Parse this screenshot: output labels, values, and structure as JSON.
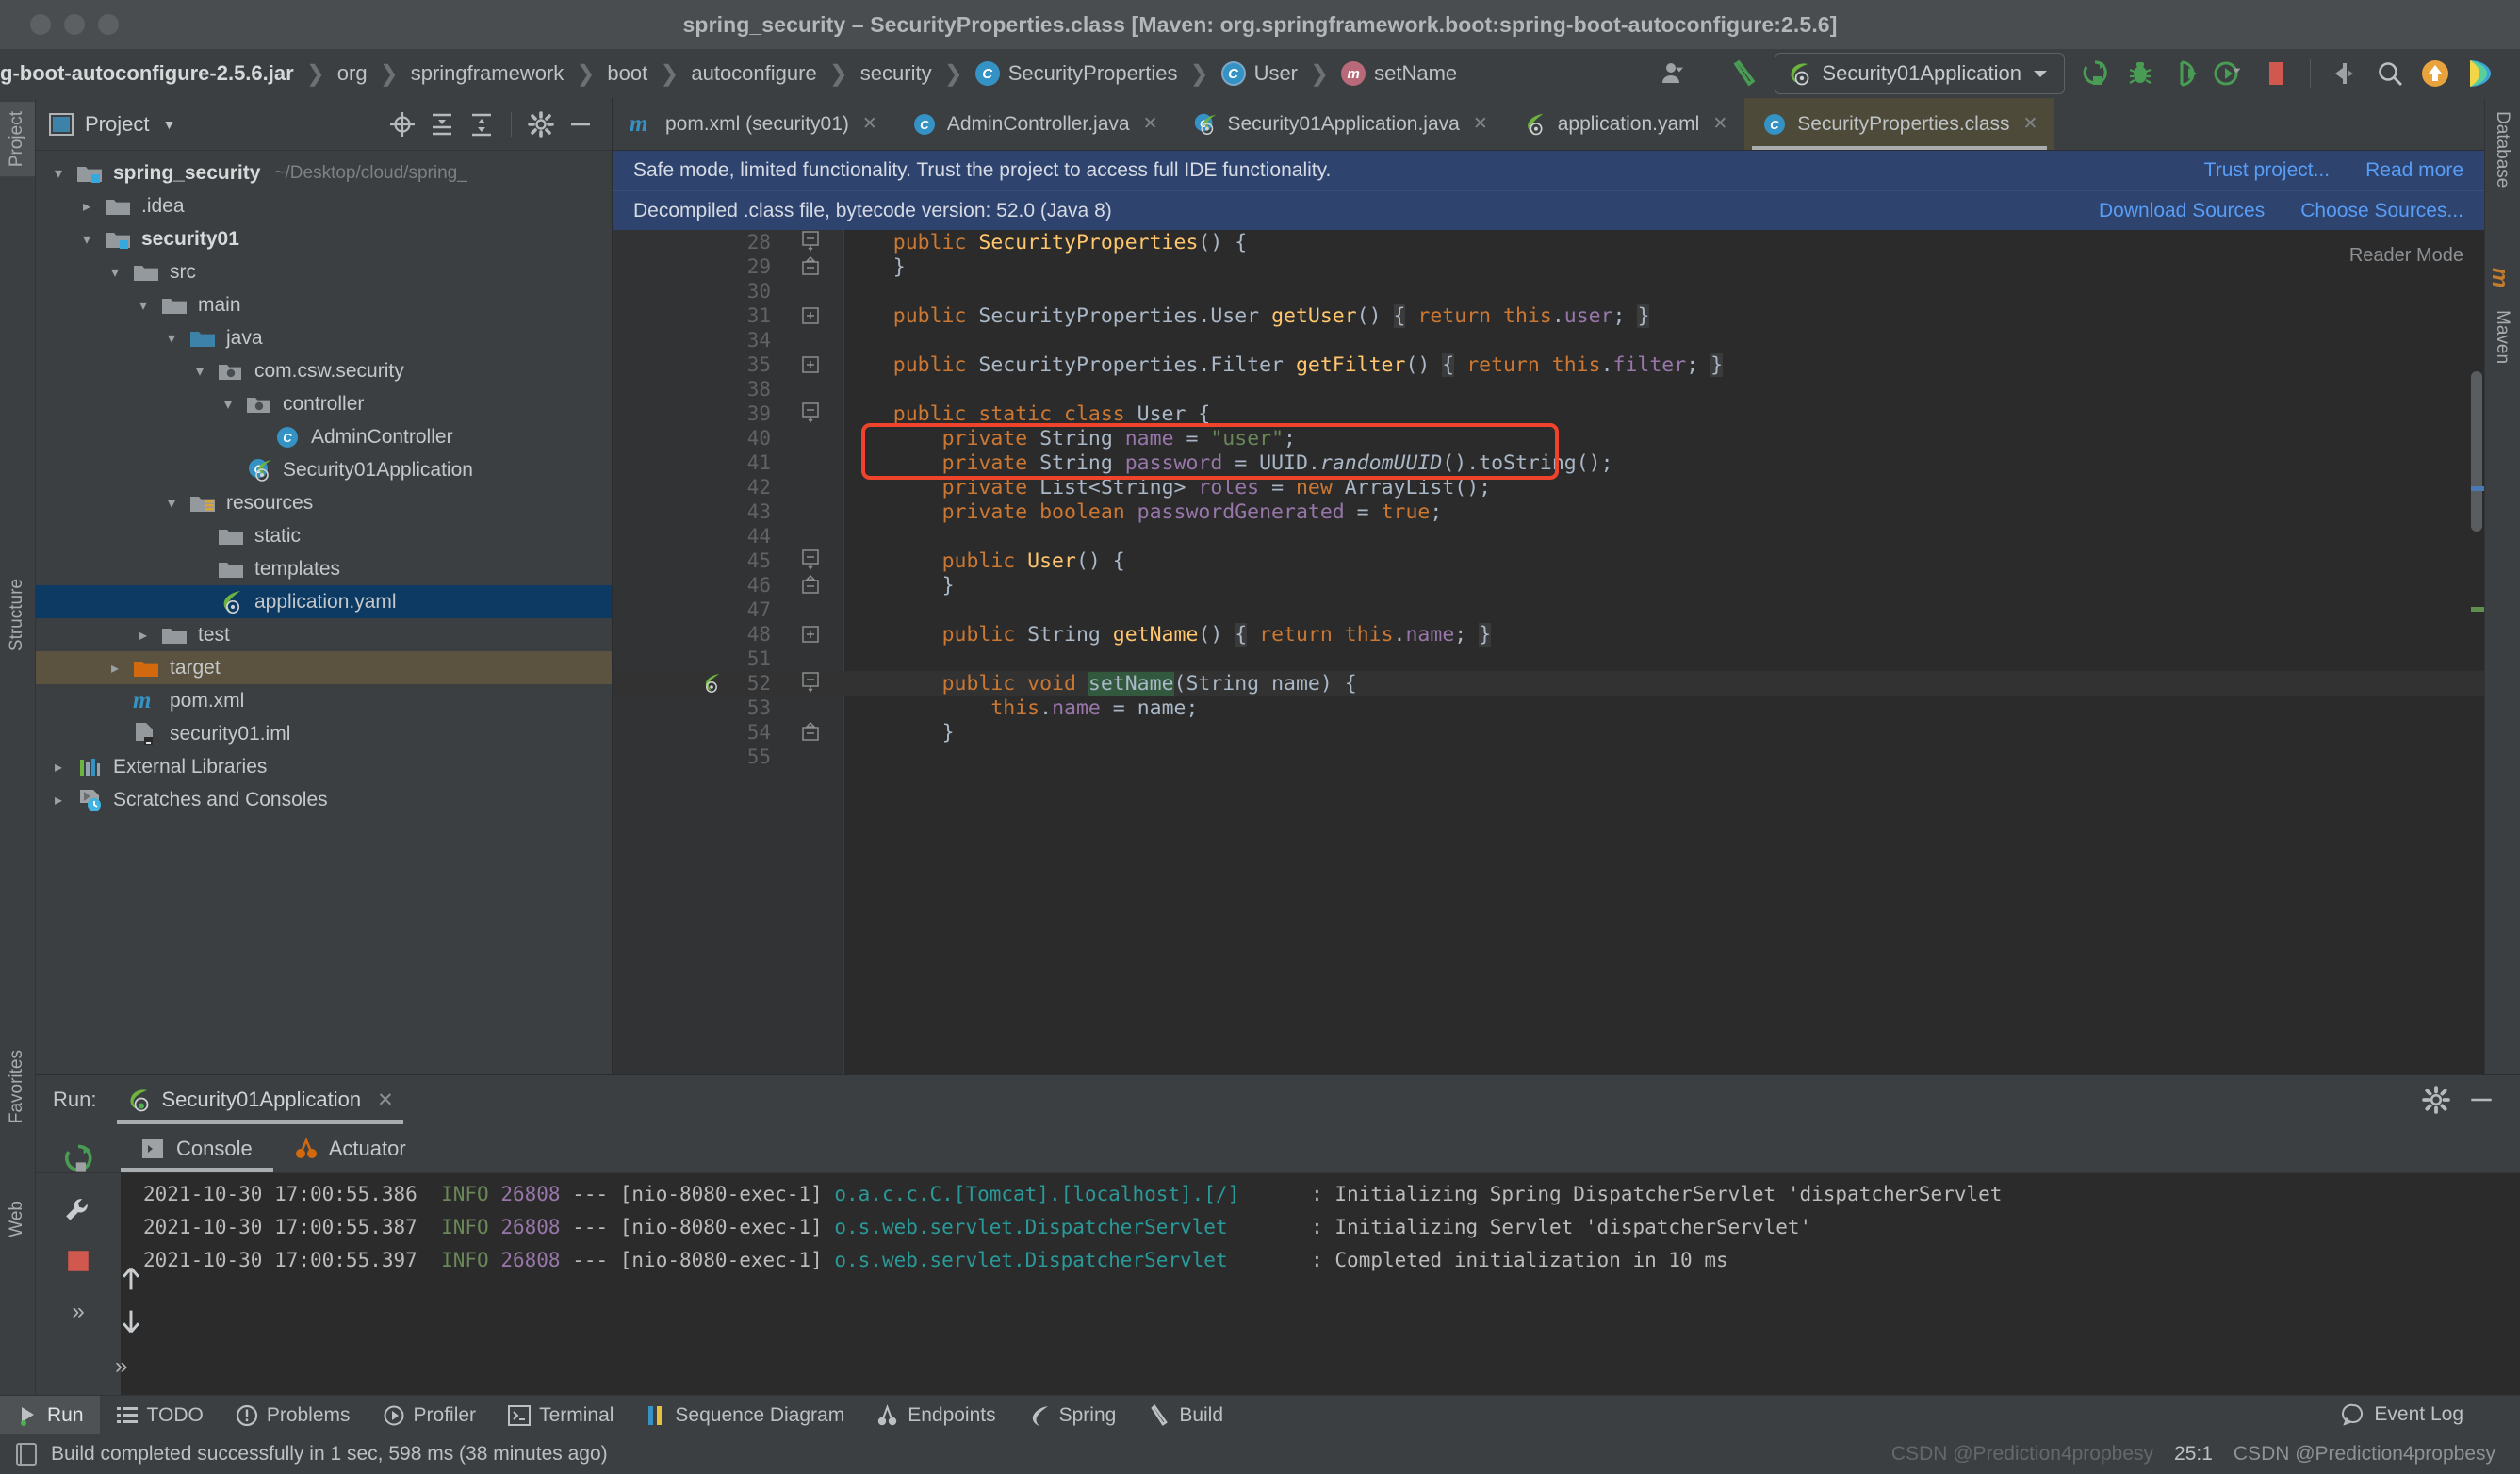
{
  "window": {
    "title": "spring_security – SecurityProperties.class [Maven: org.springframework.boot:spring-boot-autoconfigure:2.5.6]"
  },
  "breadcrumbs": [
    {
      "label": "g-boot-autoconfigure-2.5.6.jar",
      "icon": "none"
    },
    {
      "label": "org",
      "icon": "none"
    },
    {
      "label": "springframework",
      "icon": "none"
    },
    {
      "label": "boot",
      "icon": "none"
    },
    {
      "label": "autoconfigure",
      "icon": "none"
    },
    {
      "label": "security",
      "icon": "none"
    },
    {
      "label": "SecurityProperties",
      "icon": "class-icon"
    },
    {
      "label": "User",
      "icon": "inner-class-icon"
    },
    {
      "label": "setName",
      "icon": "method-icon"
    }
  ],
  "toolbar": {
    "run_config": "Security01Application",
    "buttons": [
      {
        "name": "user-settings-icon",
        "label": ""
      },
      {
        "name": "build-hammer-icon",
        "label": ""
      },
      {
        "name": "run-icon",
        "label": ""
      },
      {
        "name": "debug-icon",
        "label": ""
      },
      {
        "name": "run-coverage-icon",
        "label": ""
      },
      {
        "name": "profiler-icon",
        "label": ""
      },
      {
        "name": "stop-icon",
        "label": ""
      },
      {
        "name": "git-update-icon",
        "label": ""
      },
      {
        "name": "search-everywhere-icon",
        "label": ""
      },
      {
        "name": "updates-icon",
        "label": ""
      },
      {
        "name": "idea-logo-icon",
        "label": ""
      }
    ]
  },
  "project_panel": {
    "title": "Project",
    "actions": [
      "locate-icon",
      "expand-all-icon",
      "collapse-all-icon",
      "gear-icon",
      "minimize-icon"
    ],
    "tree": [
      {
        "label": "spring_security",
        "path": "~/Desktop/cloud/spring_",
        "depth": 0,
        "arrow": "down",
        "icon": "module-folder",
        "bold": true,
        "state": "normal"
      },
      {
        "label": ".idea",
        "path": "",
        "depth": 1,
        "arrow": "right",
        "icon": "folder",
        "bold": false,
        "state": "normal"
      },
      {
        "label": "security01",
        "path": "",
        "depth": 1,
        "arrow": "down",
        "icon": "module-folder",
        "bold": true,
        "state": "normal"
      },
      {
        "label": "src",
        "path": "",
        "depth": 2,
        "arrow": "down",
        "icon": "folder",
        "bold": false,
        "state": "normal"
      },
      {
        "label": "main",
        "path": "",
        "depth": 3,
        "arrow": "down",
        "icon": "folder",
        "bold": false,
        "state": "normal"
      },
      {
        "label": "java",
        "path": "",
        "depth": 4,
        "arrow": "down",
        "icon": "source-folder",
        "bold": false,
        "state": "normal"
      },
      {
        "label": "com.csw.security",
        "path": "",
        "depth": 5,
        "arrow": "down",
        "icon": "package",
        "bold": false,
        "state": "normal"
      },
      {
        "label": "controller",
        "path": "",
        "depth": 6,
        "arrow": "down",
        "icon": "package",
        "bold": false,
        "state": "normal"
      },
      {
        "label": "AdminController",
        "path": "",
        "depth": 7,
        "arrow": "none",
        "icon": "java-class",
        "bold": false,
        "state": "normal"
      },
      {
        "label": "Security01Application",
        "path": "",
        "depth": 6,
        "arrow": "none",
        "icon": "spring-class",
        "bold": false,
        "state": "normal"
      },
      {
        "label": "resources",
        "path": "",
        "depth": 4,
        "arrow": "down",
        "icon": "resources-folder",
        "bold": false,
        "state": "normal"
      },
      {
        "label": "static",
        "path": "",
        "depth": 5,
        "arrow": "none",
        "icon": "folder",
        "bold": false,
        "state": "normal"
      },
      {
        "label": "templates",
        "path": "",
        "depth": 5,
        "arrow": "none",
        "icon": "folder",
        "bold": false,
        "state": "normal"
      },
      {
        "label": "application.yaml",
        "path": "",
        "depth": 5,
        "arrow": "none",
        "icon": "spring-yaml",
        "bold": false,
        "state": "selected"
      },
      {
        "label": "test",
        "path": "",
        "depth": 3,
        "arrow": "right",
        "icon": "folder",
        "bold": false,
        "state": "normal"
      },
      {
        "label": "target",
        "path": "",
        "depth": 2,
        "arrow": "right",
        "icon": "target-folder",
        "bold": false,
        "state": "highlighted"
      },
      {
        "label": "pom.xml",
        "path": "",
        "depth": 2,
        "arrow": "none",
        "icon": "maven",
        "bold": false,
        "state": "normal"
      },
      {
        "label": "security01.iml",
        "path": "",
        "depth": 2,
        "arrow": "none",
        "icon": "iml",
        "bold": false,
        "state": "normal"
      },
      {
        "label": "External Libraries",
        "path": "",
        "depth": 0,
        "arrow": "right",
        "icon": "libraries",
        "bold": false,
        "state": "normal"
      },
      {
        "label": "Scratches and Consoles",
        "path": "",
        "depth": 0,
        "arrow": "right",
        "icon": "scratches",
        "bold": false,
        "state": "normal"
      }
    ]
  },
  "editor": {
    "tabs": [
      {
        "label": "pom.xml (security01)",
        "icon": "maven-icon",
        "active": false
      },
      {
        "label": "AdminController.java",
        "icon": "java-class-icon",
        "active": false
      },
      {
        "label": "Security01Application.java",
        "icon": "spring-class-icon",
        "active": false
      },
      {
        "label": "application.yaml",
        "icon": "spring-yaml-icon",
        "active": false
      },
      {
        "label": "SecurityProperties.class",
        "icon": "java-class-icon",
        "active": true
      }
    ],
    "banner1": {
      "message": "Safe mode, limited functionality. Trust the project to access full IDE functionality.",
      "links": [
        "Trust project...",
        "Read more"
      ]
    },
    "banner2": {
      "message": "Decompiled .class file, bytecode version: 52.0 (Java 8)",
      "links": [
        "Download Sources",
        "Choose Sources..."
      ]
    },
    "reader_mode": "Reader Mode",
    "lines": [
      {
        "num": "28",
        "fold": "minus-top",
        "indent": 4,
        "current": false,
        "tokens": [
          {
            "t": "public ",
            "c": "kw"
          },
          {
            "t": "SecurityProperties",
            "c": "mth"
          },
          {
            "t": "() {",
            "c": "typ"
          }
        ]
      },
      {
        "num": "29",
        "fold": "minus-bot",
        "indent": 4,
        "current": false,
        "tokens": [
          {
            "t": "}",
            "c": "typ"
          }
        ]
      },
      {
        "num": "30",
        "fold": "",
        "indent": 0,
        "current": false,
        "tokens": []
      },
      {
        "num": "31",
        "fold": "plus",
        "indent": 4,
        "current": false,
        "tokens": [
          {
            "t": "public ",
            "c": "kw"
          },
          {
            "t": "SecurityProperties.User ",
            "c": "typ"
          },
          {
            "t": "getUser",
            "c": "mth"
          },
          {
            "t": "() ",
            "c": "typ"
          },
          {
            "t": "{",
            "c": "brc"
          },
          {
            "t": " ",
            "c": "typ"
          },
          {
            "t": "return ",
            "c": "kw"
          },
          {
            "t": "this",
            "c": "kw"
          },
          {
            "t": ".",
            "c": "typ"
          },
          {
            "t": "user",
            "c": "fld"
          },
          {
            "t": "; ",
            "c": "typ"
          },
          {
            "t": "}",
            "c": "brc"
          }
        ]
      },
      {
        "num": "34",
        "fold": "",
        "indent": 0,
        "current": false,
        "tokens": []
      },
      {
        "num": "35",
        "fold": "plus",
        "indent": 4,
        "current": false,
        "tokens": [
          {
            "t": "public ",
            "c": "kw"
          },
          {
            "t": "SecurityProperties.Filter ",
            "c": "typ"
          },
          {
            "t": "getFilter",
            "c": "mth"
          },
          {
            "t": "() ",
            "c": "typ"
          },
          {
            "t": "{",
            "c": "brc"
          },
          {
            "t": " ",
            "c": "typ"
          },
          {
            "t": "return ",
            "c": "kw"
          },
          {
            "t": "this",
            "c": "kw"
          },
          {
            "t": ".",
            "c": "typ"
          },
          {
            "t": "filter",
            "c": "fld"
          },
          {
            "t": "; ",
            "c": "typ"
          },
          {
            "t": "}",
            "c": "brc"
          }
        ]
      },
      {
        "num": "38",
        "fold": "",
        "indent": 0,
        "current": false,
        "tokens": []
      },
      {
        "num": "39",
        "fold": "minus-top",
        "indent": 4,
        "current": false,
        "tokens": [
          {
            "t": "public static class ",
            "c": "kw"
          },
          {
            "t": "User ",
            "c": "typ"
          },
          {
            "t": "{",
            "c": "typ"
          }
        ]
      },
      {
        "num": "40",
        "fold": "",
        "indent": 8,
        "current": false,
        "tokens": [
          {
            "t": "private ",
            "c": "kw"
          },
          {
            "t": "String ",
            "c": "typ"
          },
          {
            "t": "name",
            "c": "fld"
          },
          {
            "t": " = ",
            "c": "typ"
          },
          {
            "t": "\"user\"",
            "c": "str"
          },
          {
            "t": ";",
            "c": "typ"
          }
        ]
      },
      {
        "num": "41",
        "fold": "",
        "indent": 8,
        "current": false,
        "tokens": [
          {
            "t": "private ",
            "c": "kw"
          },
          {
            "t": "String ",
            "c": "typ"
          },
          {
            "t": "password",
            "c": "fld"
          },
          {
            "t": " = ",
            "c": "typ"
          },
          {
            "t": "UUID.",
            "c": "typ"
          },
          {
            "t": "randomUUID",
            "c": "stc"
          },
          {
            "t": "().toString();",
            "c": "typ"
          }
        ]
      },
      {
        "num": "42",
        "fold": "",
        "indent": 8,
        "current": false,
        "tokens": [
          {
            "t": "private ",
            "c": "kw"
          },
          {
            "t": "List<String> ",
            "c": "typ"
          },
          {
            "t": "roles",
            "c": "fld"
          },
          {
            "t": " = ",
            "c": "typ"
          },
          {
            "t": "new ",
            "c": "kw"
          },
          {
            "t": "ArrayList();",
            "c": "typ"
          }
        ]
      },
      {
        "num": "43",
        "fold": "",
        "indent": 8,
        "current": false,
        "tokens": [
          {
            "t": "private boolean ",
            "c": "kw"
          },
          {
            "t": "passwordGenerated",
            "c": "fld"
          },
          {
            "t": " = ",
            "c": "typ"
          },
          {
            "t": "true",
            "c": "kw"
          },
          {
            "t": ";",
            "c": "typ"
          }
        ]
      },
      {
        "num": "44",
        "fold": "",
        "indent": 0,
        "current": false,
        "tokens": []
      },
      {
        "num": "45",
        "fold": "minus-top",
        "indent": 8,
        "current": false,
        "tokens": [
          {
            "t": "public ",
            "c": "kw"
          },
          {
            "t": "User",
            "c": "mth"
          },
          {
            "t": "() {",
            "c": "typ"
          }
        ]
      },
      {
        "num": "46",
        "fold": "minus-bot",
        "indent": 8,
        "current": false,
        "tokens": [
          {
            "t": "}",
            "c": "typ"
          }
        ]
      },
      {
        "num": "47",
        "fold": "",
        "indent": 0,
        "current": false,
        "tokens": []
      },
      {
        "num": "48",
        "fold": "plus",
        "indent": 8,
        "current": false,
        "tokens": [
          {
            "t": "public ",
            "c": "kw"
          },
          {
            "t": "String ",
            "c": "typ"
          },
          {
            "t": "getName",
            "c": "mth"
          },
          {
            "t": "() ",
            "c": "typ"
          },
          {
            "t": "{",
            "c": "brc"
          },
          {
            "t": " ",
            "c": "typ"
          },
          {
            "t": "return ",
            "c": "kw"
          },
          {
            "t": "this",
            "c": "kw"
          },
          {
            "t": ".",
            "c": "typ"
          },
          {
            "t": "name",
            "c": "fld"
          },
          {
            "t": "; ",
            "c": "typ"
          },
          {
            "t": "}",
            "c": "brc"
          }
        ]
      },
      {
        "num": "51",
        "fold": "",
        "indent": 0,
        "current": false,
        "tokens": []
      },
      {
        "num": "52",
        "fold": "minus-top",
        "indent": 8,
        "current": true,
        "gutter_icon": "spring-bean-icon",
        "tokens": [
          {
            "t": "public void ",
            "c": "kw"
          },
          {
            "t": "setName",
            "c": "hl-sel"
          },
          {
            "t": "(String name) {",
            "c": "typ"
          }
        ]
      },
      {
        "num": "53",
        "fold": "",
        "indent": 12,
        "current": false,
        "tokens": [
          {
            "t": "this",
            "c": "kw"
          },
          {
            "t": ".",
            "c": "typ"
          },
          {
            "t": "name",
            "c": "fld"
          },
          {
            "t": " = name;",
            "c": "typ"
          }
        ]
      },
      {
        "num": "54",
        "fold": "minus-bot",
        "indent": 8,
        "current": false,
        "tokens": [
          {
            "t": "}",
            "c": "typ"
          }
        ]
      },
      {
        "num": "55",
        "fold": "",
        "indent": 0,
        "current": false,
        "tokens": []
      }
    ]
  },
  "run_panel": {
    "label": "Run:",
    "config_name": "Security01Application",
    "tabs": [
      {
        "label": "Console",
        "icon": "console-icon",
        "active": true
      },
      {
        "label": "Actuator",
        "icon": "actuator-icon",
        "active": false
      }
    ],
    "console_lines": [
      {
        "ts": "2021-10-30 17:00:55.386",
        "level": "INFO",
        "pid": "26808",
        "sep": "---",
        "thread": "[nio-8080-exec-1]",
        "logger": "o.a.c.c.C.[Tomcat].[localhost].[/]",
        "pad": "      ",
        "msg": ": Initializing Spring DispatcherServlet 'dispatcherServlet"
      },
      {
        "ts": "2021-10-30 17:00:55.387",
        "level": "INFO",
        "pid": "26808",
        "sep": "---",
        "thread": "[nio-8080-exec-1]",
        "logger": "o.s.web.servlet.DispatcherServlet",
        "pad": "       ",
        "msg": ": Initializing Servlet 'dispatcherServlet'"
      },
      {
        "ts": "2021-10-30 17:00:55.397",
        "level": "INFO",
        "pid": "26808",
        "sep": "---",
        "thread": "[nio-8080-exec-1]",
        "logger": "o.s.web.servlet.DispatcherServlet",
        "pad": "       ",
        "msg": ": Completed initialization in 10 ms"
      }
    ]
  },
  "tool_windows": [
    {
      "label": "Run",
      "icon": "run-icon",
      "active": true
    },
    {
      "label": "TODO",
      "icon": "todo-icon",
      "active": false
    },
    {
      "label": "Problems",
      "icon": "problems-icon",
      "active": false
    },
    {
      "label": "Profiler",
      "icon": "profiler-icon",
      "active": false
    },
    {
      "label": "Terminal",
      "icon": "terminal-icon",
      "active": false
    },
    {
      "label": "Sequence Diagram",
      "icon": "sequence-diagram-icon",
      "active": false
    },
    {
      "label": "Endpoints",
      "icon": "endpoints-icon",
      "active": false
    },
    {
      "label": "Spring",
      "icon": "spring-icon",
      "active": false
    },
    {
      "label": "Build",
      "icon": "build-icon",
      "active": false
    }
  ],
  "event_log": "Event Log",
  "status_bar": {
    "message": "Build completed successfully in 1 sec, 598 ms (38 minutes ago)",
    "caret": "25:1",
    "watermark": "CSDN @Prediction4propbesy",
    "watermark_ghost": "CSDN @Prediction4propbesy"
  },
  "left_strip_tabs": [
    "Project",
    "Structure",
    "Favorites",
    "Web"
  ],
  "right_strip_tabs": [
    "Database",
    "Maven"
  ]
}
